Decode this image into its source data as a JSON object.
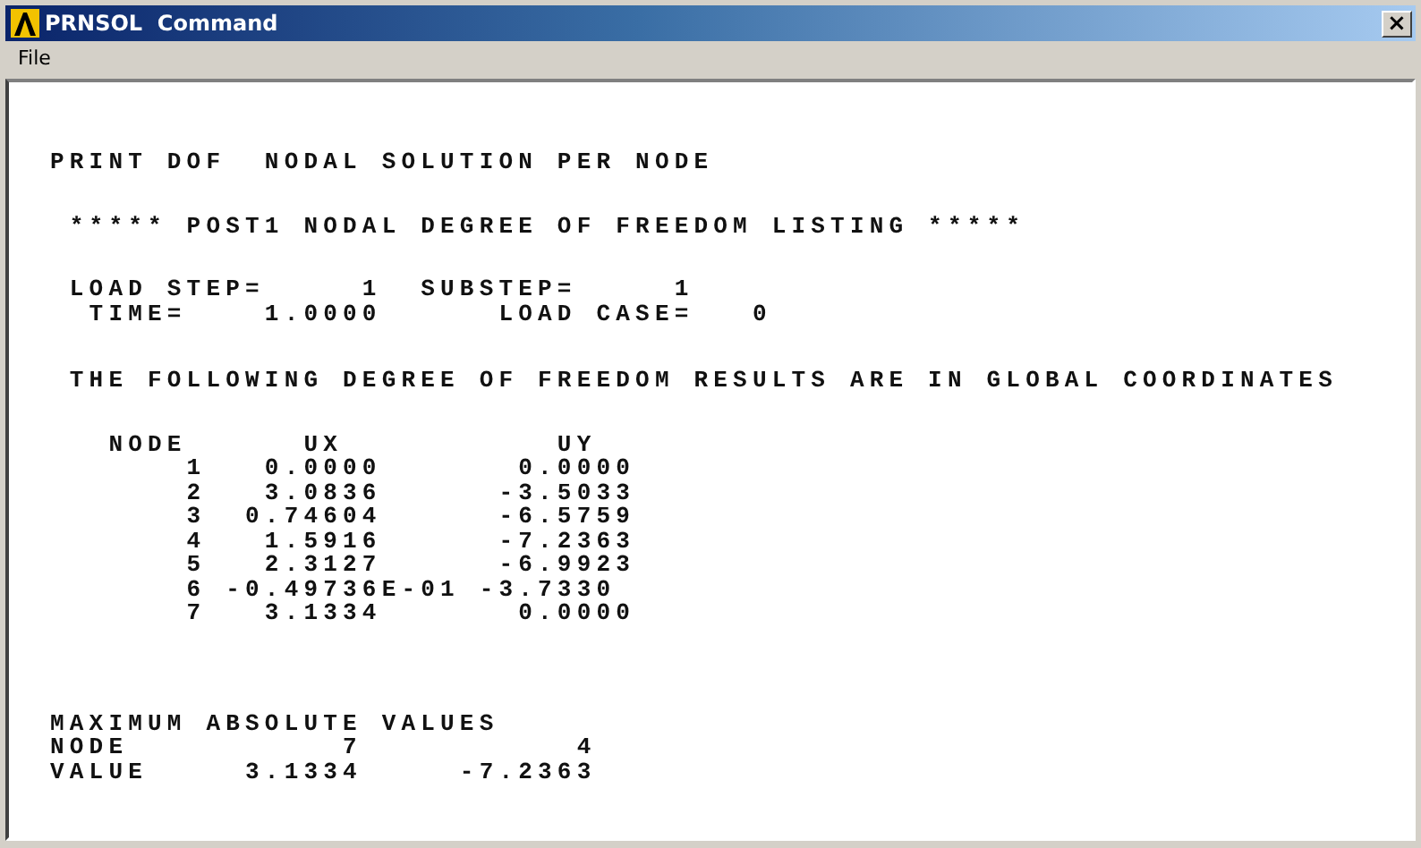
{
  "window": {
    "title": "PRNSOL  Command",
    "close": "×"
  },
  "menu": [
    "File"
  ],
  "output": [
    [
      "PRINT DOF  NODAL SOLUTION PER NODE"
    ],
    [
      " ***** POST1 NODAL DEGREE OF FREEDOM LISTING *****"
    ],
    [
      " LOAD STEP=     1  SUBSTEP=     1",
      "  TIME=    1.0000      LOAD CASE=   0"
    ],
    [
      " THE FOLLOWING DEGREE OF FREEDOM RESULTS ARE IN GLOBAL COORDINATES"
    ],
    [
      "   NODE      UX           UY",
      "       1   0.0000       0.0000",
      "       2   3.0836      -3.5033",
      "       3  0.74604      -6.5759",
      "       4   1.5916      -7.2363",
      "       5   2.3127      -6.9923",
      "       6 -0.49736E-01 -3.7330",
      "       7   3.1334       0.0000"
    ],
    [
      "MAXIMUM ABSOLUTE VALUES",
      "NODE           7           4",
      "VALUE     3.1334     -7.2363"
    ]
  ]
}
